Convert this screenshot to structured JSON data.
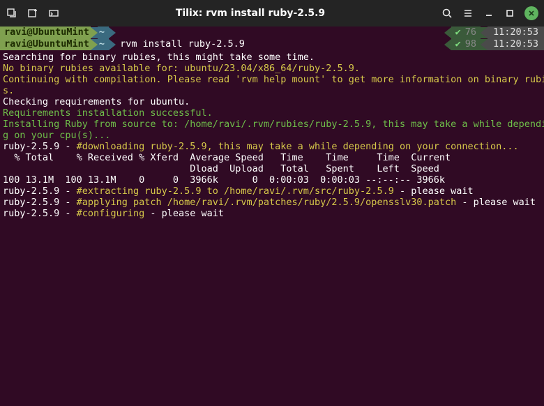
{
  "titlebar": {
    "title": "Tilix: rvm install ruby-2.5.9"
  },
  "sessions": [
    {
      "user": "ravi@UbuntuMint",
      "path": "~",
      "cmd": "",
      "code": "76",
      "time": "11:20:53"
    },
    {
      "user": "ravi@UbuntuMint",
      "path": "~",
      "cmd": "rvm install ruby-2.5.9",
      "code": "98",
      "time": "11:20:53"
    }
  ],
  "term": {
    "l1": "Searching for binary rubies, this might take some time.",
    "l2": "No binary rubies available for: ubuntu/23.04/x86_64/ruby-2.5.9.",
    "l3a": "Continuing with compilation. Please read 'rvm help mount' to get more information on binary rubie",
    "l3b": "s.",
    "l4": "Checking requirements for ubuntu.",
    "l5": "Requirements installation successful.",
    "l6a": "Installing Ruby from source to: /home/ravi/.rvm/rubies/ruby-2.5.9, this may take a while dependin",
    "l6b": "g on your cpu(s)...",
    "l7a": "ruby-2.5.9 - ",
    "l7b": "#downloading ruby-2.5.9, this may take a while depending on your connection...",
    "l8": "  % Total    % Received % Xferd  Average Speed   Time    Time     Time  Current",
    "l9": "                                 Dload  Upload   Total   Spent    Left  Speed",
    "l10": "100 13.1M  100 13.1M    0     0  3966k      0  0:00:03  0:00:03 --:--:-- 3966k",
    "l11a": "ruby-2.5.9 - ",
    "l11b": "#extracting ruby-2.5.9 to /home/ravi/.rvm/src/ruby-2.5.9",
    "l11c": " - please wait",
    "l12a": "ruby-2.5.9 - ",
    "l12b": "#applying patch /home/ravi/.rvm/patches/ruby/2.5.9/opensslv30.patch",
    "l12c": " - please wait",
    "l13a": "ruby-2.5.9 - ",
    "l13b": "#configuring",
    "l13c": " - please wait"
  }
}
